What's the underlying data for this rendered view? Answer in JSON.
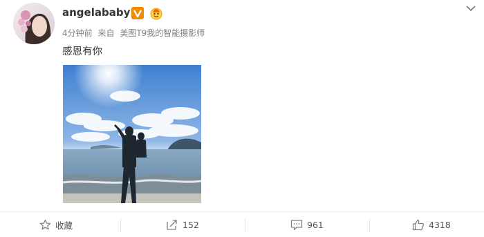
{
  "post": {
    "username": "angelababy",
    "meta": {
      "time": "4分钟前",
      "source_prefix": "来自",
      "source": "美图T9我的智能摄影师"
    },
    "content": "感恩有你",
    "actions": {
      "favorite": "收藏",
      "repost_count": "152",
      "comment_count": "961",
      "like_count": "4318"
    }
  },
  "colors": {
    "verified_badge": "#f08a00",
    "link_text": "#808080",
    "icon_gray": "#808080"
  },
  "icons": [
    "verified-badge",
    "fans-badge",
    "chevron-down",
    "star",
    "repost",
    "comment",
    "thumbs-up"
  ]
}
